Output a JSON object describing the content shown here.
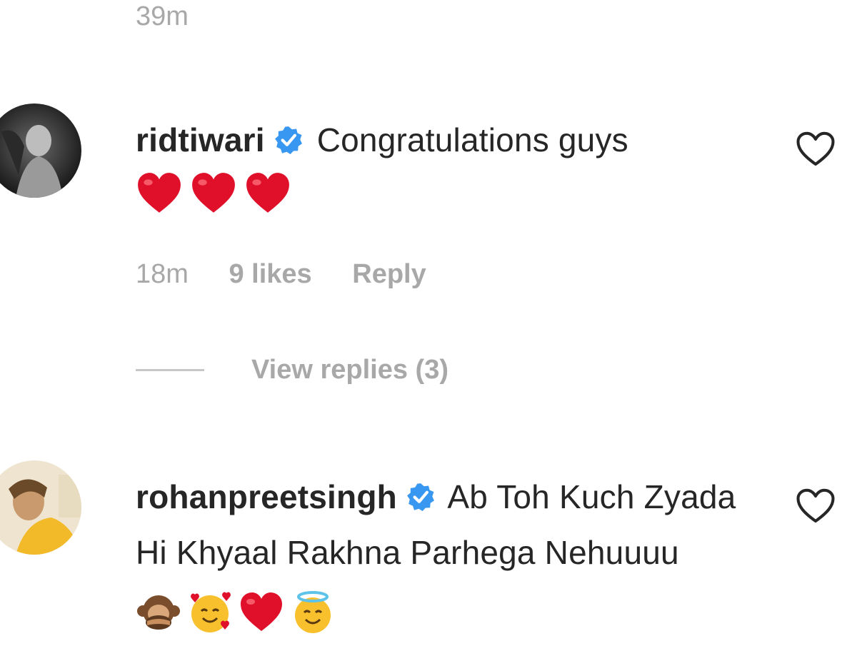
{
  "previous_comment": {
    "time": "39m"
  },
  "comments": [
    {
      "username": "ridtiwari",
      "verified": true,
      "text": "Congratulations guys",
      "emojis": [
        "red-heart",
        "red-heart",
        "red-heart"
      ],
      "time": "18m",
      "likes": "9 likes",
      "reply_label": "Reply",
      "view_replies": "View replies (3)"
    },
    {
      "username": "rohanpreetsingh",
      "verified": true,
      "text": "Ab Toh Kuch Zyada Hi Khyaal Rakhna Parhega Nehuuuu",
      "emojis": [
        "speak-no-evil-monkey",
        "smiling-face-with-hearts",
        "red-heart",
        "smiling-face-with-halo"
      ]
    }
  ],
  "colors": {
    "verified_blue": "#3897f0",
    "heart_red": "#e0102b",
    "secondary_text": "#a8a8a8",
    "primary_text": "#262626"
  }
}
